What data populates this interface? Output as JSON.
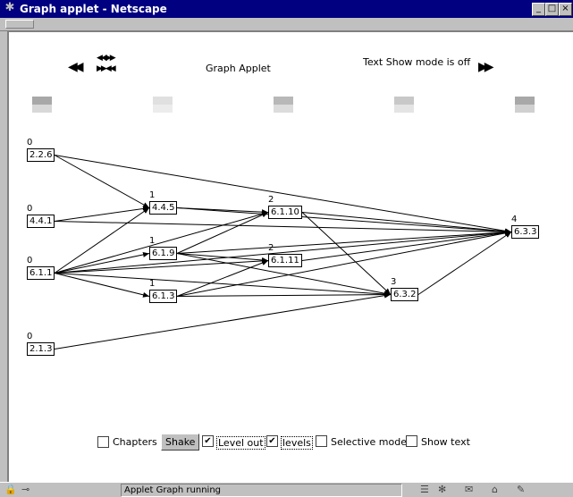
{
  "window": {
    "title": "Graph applet - Netscape",
    "minimize": "_",
    "maximize": "□",
    "close": "×"
  },
  "header": {
    "left_arrows": "◀◀",
    "mid_arrows_top": "◀◀▶▶",
    "mid_arrows_bottom": "▶▶◀◀",
    "applet_title": "Graph Applet",
    "text_show_status": "Text Show mode is off",
    "right_arrows": "▶▶"
  },
  "boxes": [
    "#a8a8a8",
    "#e0e0e0",
    "#b8b8b8",
    "#c8c8c8",
    "#a8a8a8"
  ],
  "nodes": [
    {
      "label": "2.2.6",
      "level": "0"
    },
    {
      "label": "4.4.1",
      "level": "0"
    },
    {
      "label": "6.1.1",
      "level": "0"
    },
    {
      "label": "2.1.3",
      "level": "0"
    },
    {
      "label": "4.4.5",
      "level": "1"
    },
    {
      "label": "6.1.9",
      "level": "1"
    },
    {
      "label": "6.1.3",
      "level": "1"
    },
    {
      "label": "6.1.10",
      "level": "2"
    },
    {
      "label": "6.1.11",
      "level": "2"
    },
    {
      "label": "6.3.2",
      "level": "3"
    },
    {
      "label": "6.3.3",
      "level": "4"
    }
  ],
  "edges": [
    [
      0,
      4
    ],
    [
      0,
      10
    ],
    [
      1,
      4
    ],
    [
      1,
      10
    ],
    [
      4,
      7
    ],
    [
      4,
      10
    ],
    [
      2,
      4
    ],
    [
      2,
      5
    ],
    [
      2,
      6
    ],
    [
      2,
      7
    ],
    [
      2,
      8
    ],
    [
      2,
      9
    ],
    [
      2,
      10
    ],
    [
      5,
      7
    ],
    [
      5,
      8
    ],
    [
      5,
      9
    ],
    [
      5,
      10
    ],
    [
      6,
      8
    ],
    [
      6,
      9
    ],
    [
      6,
      10
    ],
    [
      7,
      9
    ],
    [
      7,
      10
    ],
    [
      8,
      10
    ],
    [
      9,
      10
    ],
    [
      3,
      9
    ]
  ],
  "controls": {
    "chapters": {
      "label": "Chapters",
      "checked": false
    },
    "shake_label": "Shake",
    "level_out": {
      "label": "Level out",
      "checked": true
    },
    "levels": {
      "label": "levels",
      "checked": true
    },
    "selective": {
      "label": "Selective mode",
      "checked": false
    },
    "show_text": {
      "label": "Show text",
      "checked": false
    },
    "check_mark": "✔"
  },
  "status": {
    "text": "Applet Graph running",
    "security_icon": "⊸",
    "icons": [
      "☰",
      "✻",
      "✉",
      "⌂",
      "✎"
    ]
  }
}
